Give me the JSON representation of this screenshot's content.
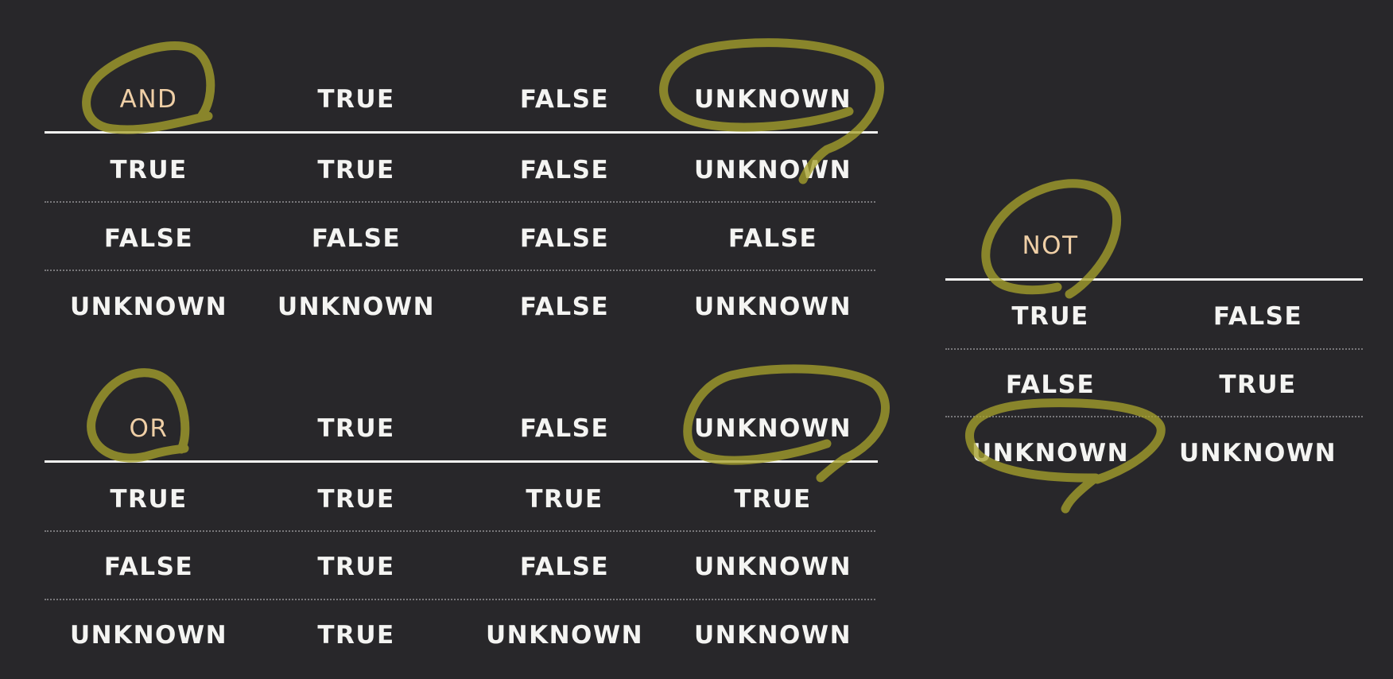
{
  "and_table": {
    "header": [
      "AND",
      "TRUE",
      "FALSE",
      "UNKNOWN"
    ],
    "rows": [
      [
        "TRUE",
        "TRUE",
        "FALSE",
        "UNKNOWN"
      ],
      [
        "FALSE",
        "FALSE",
        "FALSE",
        "FALSE"
      ],
      [
        "UNKNOWN",
        "UNKNOWN",
        "FALSE",
        "UNKNOWN"
      ]
    ]
  },
  "or_table": {
    "header": [
      "OR",
      "TRUE",
      "FALSE",
      "UNKNOWN"
    ],
    "rows": [
      [
        "TRUE",
        "TRUE",
        "TRUE",
        "TRUE"
      ],
      [
        "FALSE",
        "TRUE",
        "FALSE",
        "UNKNOWN"
      ],
      [
        "UNKNOWN",
        "TRUE",
        "UNKNOWN",
        "UNKNOWN"
      ]
    ]
  },
  "not_table": {
    "header": [
      "NOT"
    ],
    "rows": [
      [
        "TRUE",
        "FALSE"
      ],
      [
        "FALSE",
        "TRUE"
      ],
      [
        "UNKNOWN",
        "UNKNOWN"
      ]
    ]
  },
  "colors": {
    "background": "#28272a",
    "text": "#f4f4f2",
    "operator_text": "#efcfa6",
    "highlight_stroke": "#a5a02c",
    "dotted_separator": "#78777a"
  }
}
